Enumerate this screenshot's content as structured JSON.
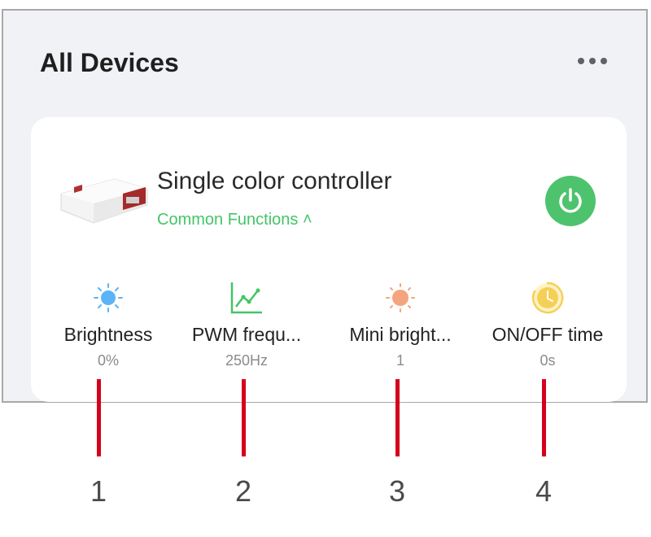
{
  "header": {
    "title": "All Devices",
    "more_icon": "more-horizontal-icon"
  },
  "device": {
    "name": "Single color controller",
    "common_functions": "Common Functions ˄",
    "power_icon": "power-icon",
    "power_color": "#4ec36e"
  },
  "functions": [
    {
      "label": "Brightness",
      "value": "0%",
      "icon": "sun-blue-icon",
      "color": "#5ab4f7"
    },
    {
      "label": "PWM frequ...",
      "value": "250Hz",
      "icon": "line-chart-icon",
      "color": "#43c567"
    },
    {
      "label": "Mini bright...",
      "value": "1",
      "icon": "sun-orange-icon",
      "color": "#f5a47e"
    },
    {
      "label": "ON/OFF time",
      "value": "0s",
      "icon": "timer-icon",
      "color": "#f6cf57"
    }
  ],
  "callouts": [
    "1",
    "2",
    "3",
    "4"
  ],
  "colors": {
    "accent_green": "#43c567",
    "callout_red": "#d5001c"
  }
}
